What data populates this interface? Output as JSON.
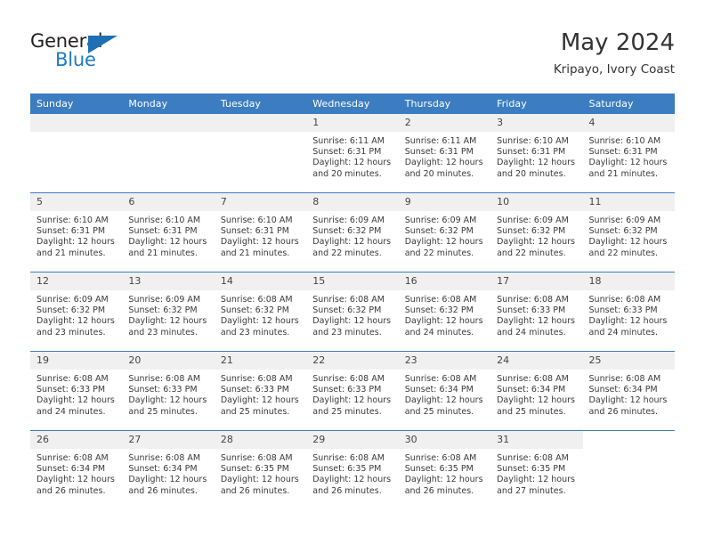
{
  "logo": {
    "word_top": "General",
    "word_bottom": "Blue",
    "accent_color": "#1f6fb5"
  },
  "header": {
    "title": "May 2024",
    "subtitle": "Kripayo, Ivory Coast"
  },
  "calendar": {
    "header_bg": "#3b7dc0",
    "daynum_bg": "#f0f0f0",
    "weekdays": [
      "Sunday",
      "Monday",
      "Tuesday",
      "Wednesday",
      "Thursday",
      "Friday",
      "Saturday"
    ],
    "weeks": [
      [
        {
          "day": "",
          "sunrise": "",
          "sunset": "",
          "daylight_line1": "",
          "daylight_line2": "",
          "empty": true
        },
        {
          "day": "",
          "sunrise": "",
          "sunset": "",
          "daylight_line1": "",
          "daylight_line2": "",
          "empty": true
        },
        {
          "day": "",
          "sunrise": "",
          "sunset": "",
          "daylight_line1": "",
          "daylight_line2": "",
          "empty": true
        },
        {
          "day": "1",
          "sunrise": "Sunrise: 6:11 AM",
          "sunset": "Sunset: 6:31 PM",
          "daylight_line1": "Daylight: 12 hours",
          "daylight_line2": "and 20 minutes."
        },
        {
          "day": "2",
          "sunrise": "Sunrise: 6:11 AM",
          "sunset": "Sunset: 6:31 PM",
          "daylight_line1": "Daylight: 12 hours",
          "daylight_line2": "and 20 minutes."
        },
        {
          "day": "3",
          "sunrise": "Sunrise: 6:10 AM",
          "sunset": "Sunset: 6:31 PM",
          "daylight_line1": "Daylight: 12 hours",
          "daylight_line2": "and 20 minutes."
        },
        {
          "day": "4",
          "sunrise": "Sunrise: 6:10 AM",
          "sunset": "Sunset: 6:31 PM",
          "daylight_line1": "Daylight: 12 hours",
          "daylight_line2": "and 21 minutes."
        }
      ],
      [
        {
          "day": "5",
          "sunrise": "Sunrise: 6:10 AM",
          "sunset": "Sunset: 6:31 PM",
          "daylight_line1": "Daylight: 12 hours",
          "daylight_line2": "and 21 minutes."
        },
        {
          "day": "6",
          "sunrise": "Sunrise: 6:10 AM",
          "sunset": "Sunset: 6:31 PM",
          "daylight_line1": "Daylight: 12 hours",
          "daylight_line2": "and 21 minutes."
        },
        {
          "day": "7",
          "sunrise": "Sunrise: 6:10 AM",
          "sunset": "Sunset: 6:31 PM",
          "daylight_line1": "Daylight: 12 hours",
          "daylight_line2": "and 21 minutes."
        },
        {
          "day": "8",
          "sunrise": "Sunrise: 6:09 AM",
          "sunset": "Sunset: 6:32 PM",
          "daylight_line1": "Daylight: 12 hours",
          "daylight_line2": "and 22 minutes."
        },
        {
          "day": "9",
          "sunrise": "Sunrise: 6:09 AM",
          "sunset": "Sunset: 6:32 PM",
          "daylight_line1": "Daylight: 12 hours",
          "daylight_line2": "and 22 minutes."
        },
        {
          "day": "10",
          "sunrise": "Sunrise: 6:09 AM",
          "sunset": "Sunset: 6:32 PM",
          "daylight_line1": "Daylight: 12 hours",
          "daylight_line2": "and 22 minutes."
        },
        {
          "day": "11",
          "sunrise": "Sunrise: 6:09 AM",
          "sunset": "Sunset: 6:32 PM",
          "daylight_line1": "Daylight: 12 hours",
          "daylight_line2": "and 22 minutes."
        }
      ],
      [
        {
          "day": "12",
          "sunrise": "Sunrise: 6:09 AM",
          "sunset": "Sunset: 6:32 PM",
          "daylight_line1": "Daylight: 12 hours",
          "daylight_line2": "and 23 minutes."
        },
        {
          "day": "13",
          "sunrise": "Sunrise: 6:09 AM",
          "sunset": "Sunset: 6:32 PM",
          "daylight_line1": "Daylight: 12 hours",
          "daylight_line2": "and 23 minutes."
        },
        {
          "day": "14",
          "sunrise": "Sunrise: 6:08 AM",
          "sunset": "Sunset: 6:32 PM",
          "daylight_line1": "Daylight: 12 hours",
          "daylight_line2": "and 23 minutes."
        },
        {
          "day": "15",
          "sunrise": "Sunrise: 6:08 AM",
          "sunset": "Sunset: 6:32 PM",
          "daylight_line1": "Daylight: 12 hours",
          "daylight_line2": "and 23 minutes."
        },
        {
          "day": "16",
          "sunrise": "Sunrise: 6:08 AM",
          "sunset": "Sunset: 6:32 PM",
          "daylight_line1": "Daylight: 12 hours",
          "daylight_line2": "and 24 minutes."
        },
        {
          "day": "17",
          "sunrise": "Sunrise: 6:08 AM",
          "sunset": "Sunset: 6:33 PM",
          "daylight_line1": "Daylight: 12 hours",
          "daylight_line2": "and 24 minutes."
        },
        {
          "day": "18",
          "sunrise": "Sunrise: 6:08 AM",
          "sunset": "Sunset: 6:33 PM",
          "daylight_line1": "Daylight: 12 hours",
          "daylight_line2": "and 24 minutes."
        }
      ],
      [
        {
          "day": "19",
          "sunrise": "Sunrise: 6:08 AM",
          "sunset": "Sunset: 6:33 PM",
          "daylight_line1": "Daylight: 12 hours",
          "daylight_line2": "and 24 minutes."
        },
        {
          "day": "20",
          "sunrise": "Sunrise: 6:08 AM",
          "sunset": "Sunset: 6:33 PM",
          "daylight_line1": "Daylight: 12 hours",
          "daylight_line2": "and 25 minutes."
        },
        {
          "day": "21",
          "sunrise": "Sunrise: 6:08 AM",
          "sunset": "Sunset: 6:33 PM",
          "daylight_line1": "Daylight: 12 hours",
          "daylight_line2": "and 25 minutes."
        },
        {
          "day": "22",
          "sunrise": "Sunrise: 6:08 AM",
          "sunset": "Sunset: 6:33 PM",
          "daylight_line1": "Daylight: 12 hours",
          "daylight_line2": "and 25 minutes."
        },
        {
          "day": "23",
          "sunrise": "Sunrise: 6:08 AM",
          "sunset": "Sunset: 6:34 PM",
          "daylight_line1": "Daylight: 12 hours",
          "daylight_line2": "and 25 minutes."
        },
        {
          "day": "24",
          "sunrise": "Sunrise: 6:08 AM",
          "sunset": "Sunset: 6:34 PM",
          "daylight_line1": "Daylight: 12 hours",
          "daylight_line2": "and 25 minutes."
        },
        {
          "day": "25",
          "sunrise": "Sunrise: 6:08 AM",
          "sunset": "Sunset: 6:34 PM",
          "daylight_line1": "Daylight: 12 hours",
          "daylight_line2": "and 26 minutes."
        }
      ],
      [
        {
          "day": "26",
          "sunrise": "Sunrise: 6:08 AM",
          "sunset": "Sunset: 6:34 PM",
          "daylight_line1": "Daylight: 12 hours",
          "daylight_line2": "and 26 minutes."
        },
        {
          "day": "27",
          "sunrise": "Sunrise: 6:08 AM",
          "sunset": "Sunset: 6:34 PM",
          "daylight_line1": "Daylight: 12 hours",
          "daylight_line2": "and 26 minutes."
        },
        {
          "day": "28",
          "sunrise": "Sunrise: 6:08 AM",
          "sunset": "Sunset: 6:35 PM",
          "daylight_line1": "Daylight: 12 hours",
          "daylight_line2": "and 26 minutes."
        },
        {
          "day": "29",
          "sunrise": "Sunrise: 6:08 AM",
          "sunset": "Sunset: 6:35 PM",
          "daylight_line1": "Daylight: 12 hours",
          "daylight_line2": "and 26 minutes."
        },
        {
          "day": "30",
          "sunrise": "Sunrise: 6:08 AM",
          "sunset": "Sunset: 6:35 PM",
          "daylight_line1": "Daylight: 12 hours",
          "daylight_line2": "and 26 minutes."
        },
        {
          "day": "31",
          "sunrise": "Sunrise: 6:08 AM",
          "sunset": "Sunset: 6:35 PM",
          "daylight_line1": "Daylight: 12 hours",
          "daylight_line2": "and 27 minutes."
        },
        {
          "day": "",
          "sunrise": "",
          "sunset": "",
          "daylight_line1": "",
          "daylight_line2": "",
          "blank": true
        }
      ]
    ]
  }
}
